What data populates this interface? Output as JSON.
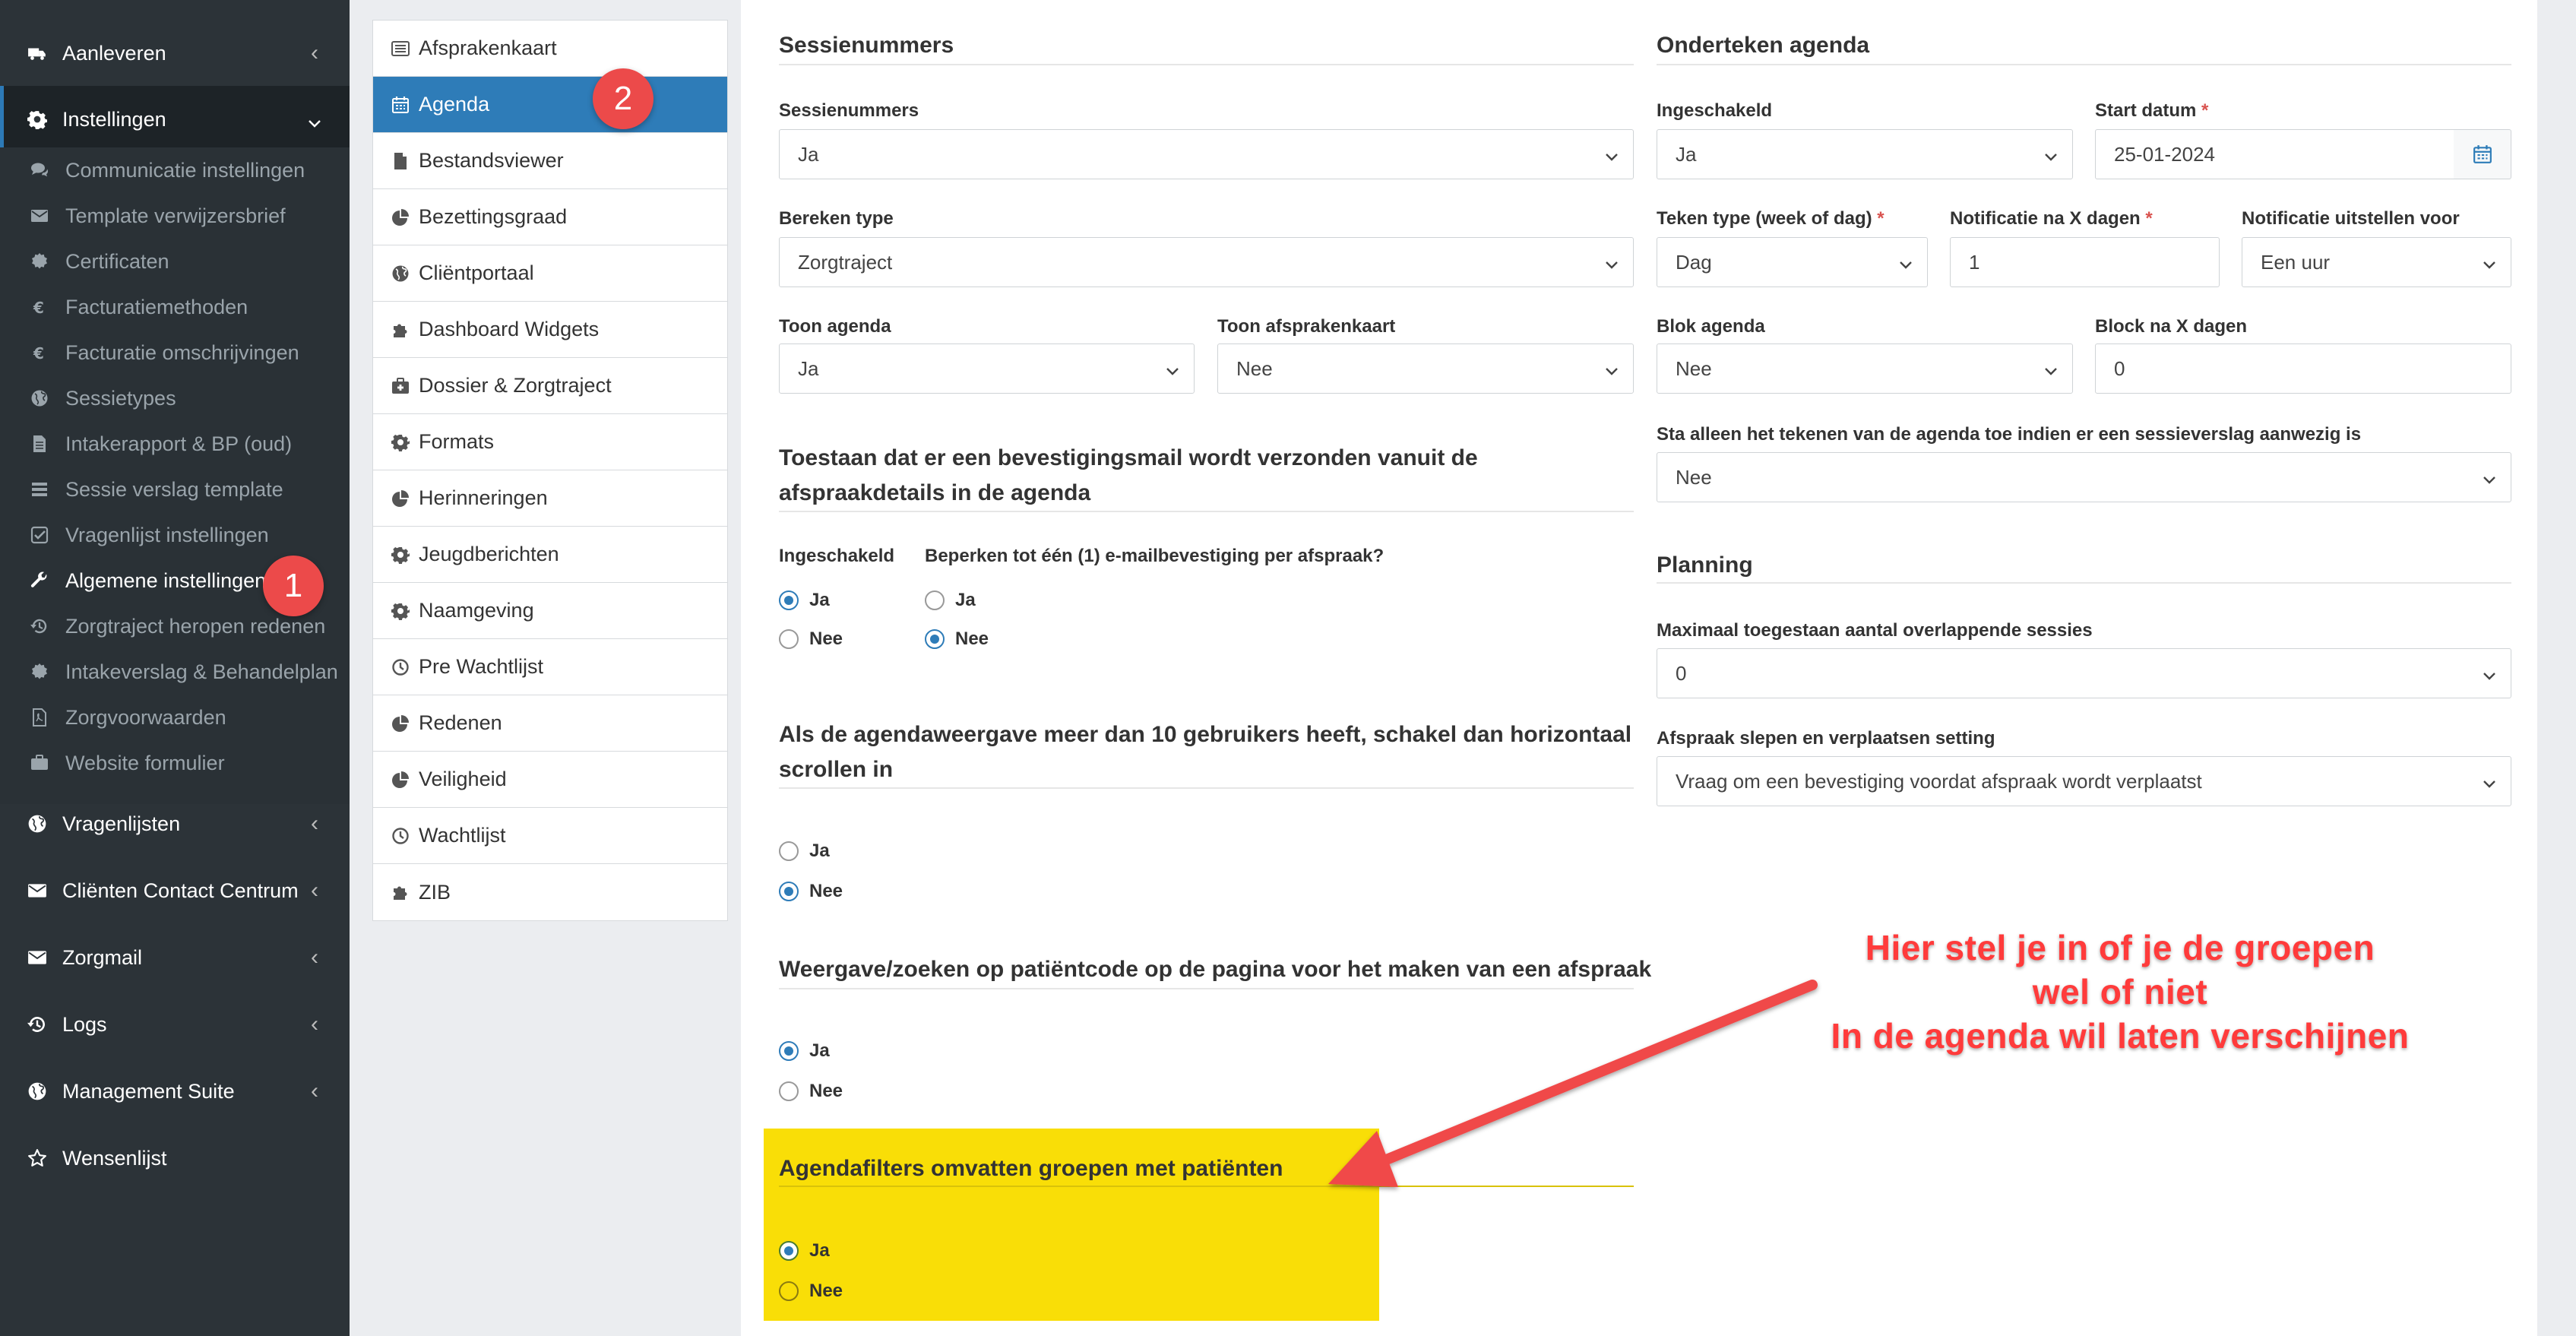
{
  "sidebar": {
    "top_items": [
      {
        "label": "Aanleveren",
        "icon": "truck-icon"
      },
      {
        "label": "Instellingen",
        "icon": "gear-icon"
      }
    ],
    "sub_items": [
      {
        "label": "Communicatie instellingen",
        "icon": "comments-icon"
      },
      {
        "label": "Template verwijzersbrief",
        "icon": "envelope-icon"
      },
      {
        "label": "Certificaten",
        "icon": "certificate-icon"
      },
      {
        "label": "Facturatiemethoden",
        "icon": "euro-icon"
      },
      {
        "label": "Facturatie omschrijvingen",
        "icon": "euro-icon"
      },
      {
        "label": "Sessietypes",
        "icon": "globe-icon"
      },
      {
        "label": "Intakerapport & BP (oud)",
        "icon": "file-icon"
      },
      {
        "label": "Sessie verslag template",
        "icon": "list-icon"
      },
      {
        "label": "Vragenlijst instellingen",
        "icon": "check-square-icon"
      },
      {
        "label": "Algemene instellingen",
        "icon": "wrench-icon"
      },
      {
        "label": "Zorgtraject heropen redenen",
        "icon": "history-icon"
      },
      {
        "label": "Intakeverslag & Behandelplan",
        "icon": "cog-icon"
      },
      {
        "label": "Zorgvoorwaarden",
        "icon": "pdf-file-icon"
      },
      {
        "label": "Website formulier",
        "icon": "briefcase-icon"
      }
    ],
    "bottom_items": [
      {
        "label": "Vragenlijsten",
        "icon": "globe-icon"
      },
      {
        "label": "Cliënten Contact Centrum",
        "icon": "envelope-icon"
      },
      {
        "label": "Zorgmail",
        "icon": "envelope-icon"
      },
      {
        "label": "Logs",
        "icon": "history-icon"
      },
      {
        "label": "Management Suite",
        "icon": "globe-icon"
      },
      {
        "label": "Wensenlijst",
        "icon": "star-icon"
      }
    ]
  },
  "annotations": {
    "step1": "1",
    "step2": "2",
    "callout": [
      "Hier stel je in of je de groepen",
      "wel of niet",
      "In de agenda wil laten verschijnen"
    ],
    "colors": {
      "badge": "#ec4a4a",
      "highlight": "#f9de07",
      "arrow": "#f04848",
      "callout_text": "#ff3b3b"
    }
  },
  "settings_menu": {
    "items": [
      {
        "label": "Afsprakenkaart",
        "icon": "list-alt-icon"
      },
      {
        "label": "Agenda",
        "icon": "calendar-icon"
      },
      {
        "label": "Bestandsviewer",
        "icon": "file-icon"
      },
      {
        "label": "Bezettingsgraad",
        "icon": "pie-chart-icon"
      },
      {
        "label": "Cliëntportaal",
        "icon": "globe-icon"
      },
      {
        "label": "Dashboard Widgets",
        "icon": "puzzle-icon"
      },
      {
        "label": "Dossier & Zorgtraject",
        "icon": "medkit-icon"
      },
      {
        "label": "Formats",
        "icon": "gear-icon"
      },
      {
        "label": "Herinneringen",
        "icon": "pie-chart-icon"
      },
      {
        "label": "Jeugdberichten",
        "icon": "gear-icon"
      },
      {
        "label": "Naamgeving",
        "icon": "gear-icon"
      },
      {
        "label": "Pre Wachtlijst",
        "icon": "clock-icon"
      },
      {
        "label": "Redenen",
        "icon": "pie-chart-icon"
      },
      {
        "label": "Veiligheid",
        "icon": "pie-chart-icon"
      },
      {
        "label": "Wachtlijst",
        "icon": "clock-icon"
      },
      {
        "label": "ZIB",
        "icon": "puzzle-icon"
      }
    ],
    "accent": "#2e7cb8"
  },
  "left_col": {
    "sessie_title": "Sessienummers",
    "sessie_label": "Sessienummers",
    "sessie_value": "Ja",
    "bereken_label": "Bereken type",
    "bereken_value": "Zorgtraject",
    "toon_agenda_label": "Toon agenda",
    "toon_agenda_value": "Ja",
    "toon_kaart_label": "Toon afsprakenkaart",
    "toon_kaart_value": "Nee",
    "mail_title": "Toestaan dat er een bevestigingsmail wordt verzonden vanuit de afspraakdetails in de agenda",
    "ingeschakeld_label": "Ingeschakeld",
    "beperken_label": "Beperken tot één (1) e-mailbevestiging per afspraak?",
    "ja": "Ja",
    "nee": "Nee",
    "scroll_title": "Als de agendaweergave meer dan 10 gebruikers heeft, schakel dan horizontaal scrollen in",
    "patient_title": "Weergave/zoeken op patiëntcode op de pagina voor het maken van een afspraak",
    "filters_title": "Agendafilters omvatten groepen met patiënten"
  },
  "right_col": {
    "onderteken_title": "Onderteken agenda",
    "ingeschakeld_label": "Ingeschakeld",
    "ingeschakeld_value": "Ja",
    "start_label": "Start datum",
    "start_value": "25-01-2024",
    "required_mark": "*",
    "teken_label": "Teken type (week of dag)",
    "teken_value": "Dag",
    "notif_label": "Notificatie na X dagen",
    "notif_value": "1",
    "uitstellen_label": "Notificatie uitstellen voor",
    "uitstellen_value": "Een uur",
    "blok_label": "Blok agenda",
    "blok_value": "Nee",
    "block_dagen_label": "Block na X dagen",
    "block_dagen_value": "0",
    "sta_label": "Sta alleen het tekenen van de agenda toe indien er een sessieverslag aanwezig is",
    "sta_value": "Nee",
    "planning_title": "Planning",
    "max_label": "Maximaal toegestaan aantal overlappende sessies",
    "max_value": "0",
    "slepen_label": "Afspraak slepen en verplaatsen setting",
    "slepen_value": "Vraag om een bevestiging voordat afspraak wordt verplaatst"
  }
}
